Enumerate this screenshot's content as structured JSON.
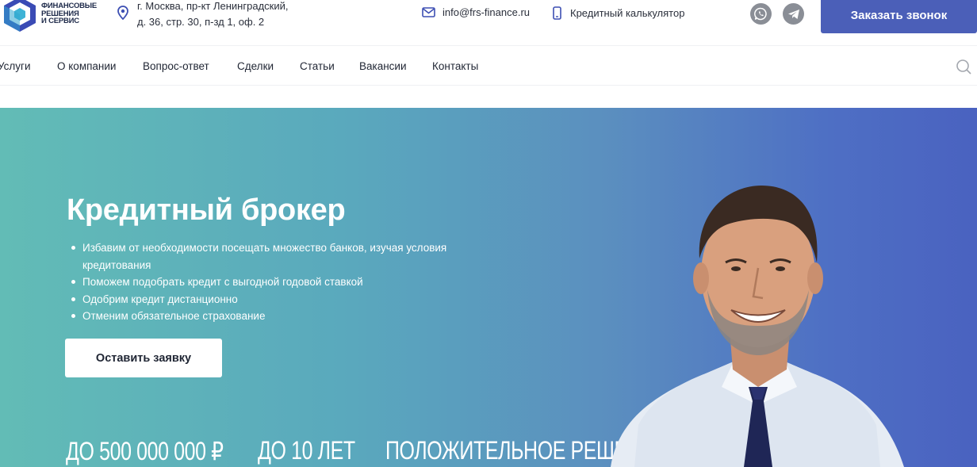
{
  "header": {
    "logo_lines": [
      "ФИНАНСОВЫЕ",
      "РЕШЕНИЯ",
      "И СЕРВИС"
    ],
    "address_line1": "г. Москва, пр-кт Ленинградский,",
    "address_line2": "д. 36, стр. 30, п-зд 1, оф. 2",
    "email": "info@frs-finance.ru",
    "calculator": "Кредитный калькулятор",
    "social_icons": [
      "whatsapp-icon",
      "telegram-icon"
    ],
    "call_button": "Заказать звонок",
    "accent_color": "#4b5fb8"
  },
  "nav": {
    "items": [
      "Услуги",
      "О компании",
      "Вопрос-ответ",
      "Сделки",
      "Статьи",
      "Вакансии",
      "Контакты"
    ]
  },
  "hero": {
    "title": "Кредитный брокер",
    "bullets": [
      "Избавим от необходимости посещать множество банков, изучая условия кредитования",
      "Поможем подобрать кредит с выгодной годовой ставкой",
      "Одобрим кредит дистанционно",
      "Отменим обязательное страхование"
    ],
    "cta": "Оставить заявку",
    "stats": [
      "ДО 500 000 000 ₽",
      "ДО 10 ЛЕТ",
      "ПОЛОЖИТЕЛЬНОЕ РЕШЕНИЕ"
    ],
    "gradient_colors": [
      "#62bcb6",
      "#4a62c0"
    ]
  }
}
